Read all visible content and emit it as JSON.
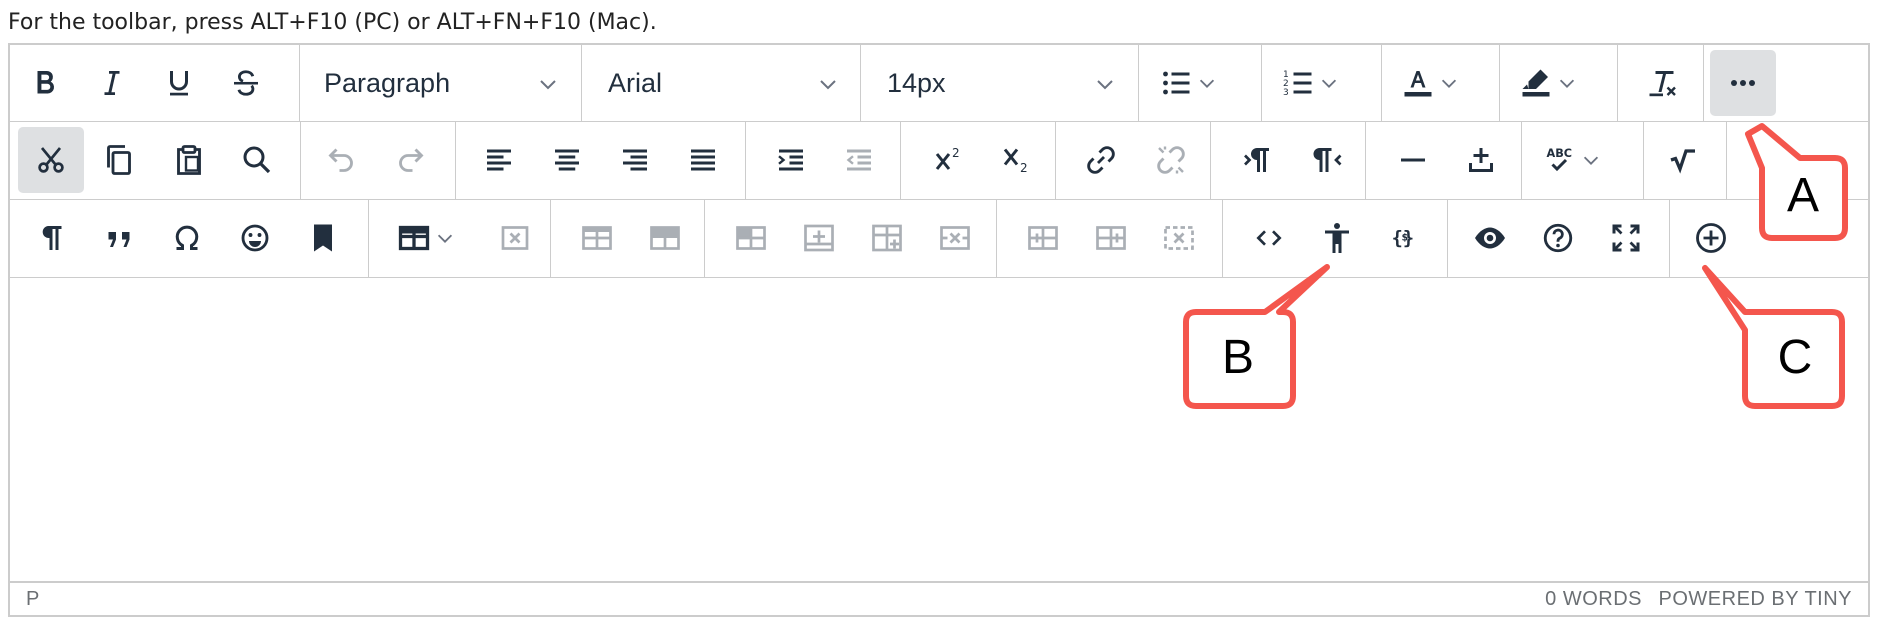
{
  "instruction": "For the toolbar, press ALT+F10 (PC) or ALT+FN+F10 (Mac).",
  "toolbar": {
    "block_format": "Paragraph",
    "font_family": "Arial",
    "font_size": "14px"
  },
  "icons": {
    "row1": [
      "bold-icon",
      "italic-icon",
      "underline-icon",
      "strikethrough-icon",
      "bullet-list-icon",
      "numbered-list-icon",
      "text-color-icon",
      "highlight-color-icon",
      "clear-formatting-icon",
      "more-icon"
    ],
    "row2": [
      "cut-icon",
      "copy-icon",
      "paste-icon",
      "find-replace-icon",
      "undo-icon",
      "redo-icon",
      "align-left-icon",
      "align-center-icon",
      "align-right-icon",
      "justify-icon",
      "indent-icon",
      "outdent-icon",
      "superscript-icon",
      "subscript-icon",
      "link-icon",
      "unlink-icon",
      "ltr-icon",
      "rtl-icon",
      "horizontal-line-icon",
      "insert-icon",
      "spellcheck-icon",
      "math-icon"
    ],
    "row3": [
      "paragraph-mark-icon",
      "blockquote-icon",
      "special-char-icon",
      "emoji-icon",
      "bookmark-icon",
      "table-icon",
      "delete-table-icon",
      "table-row-icon",
      "table-cell-icon",
      "table-header-icon",
      "insert-row-icon",
      "insert-column-icon",
      "delete-column-icon",
      "split-cell-icon",
      "merge-cell-icon",
      "delete-cell-icon",
      "code-icon",
      "accessibility-icon",
      "template-icon",
      "preview-icon",
      "help-icon",
      "fullscreen-icon",
      "add-content-icon"
    ]
  },
  "statusbar": {
    "path": "P",
    "word_count": "0 WORDS",
    "branding": "POWERED BY TINY"
  },
  "callouts": {
    "a": "A",
    "b": "B",
    "c": "C"
  },
  "colors": {
    "icon": "#222f3e",
    "border": "#cccccc",
    "active_bg": "#dee0e2",
    "callout": "#f4564d",
    "status_text": "#6b6f73"
  }
}
